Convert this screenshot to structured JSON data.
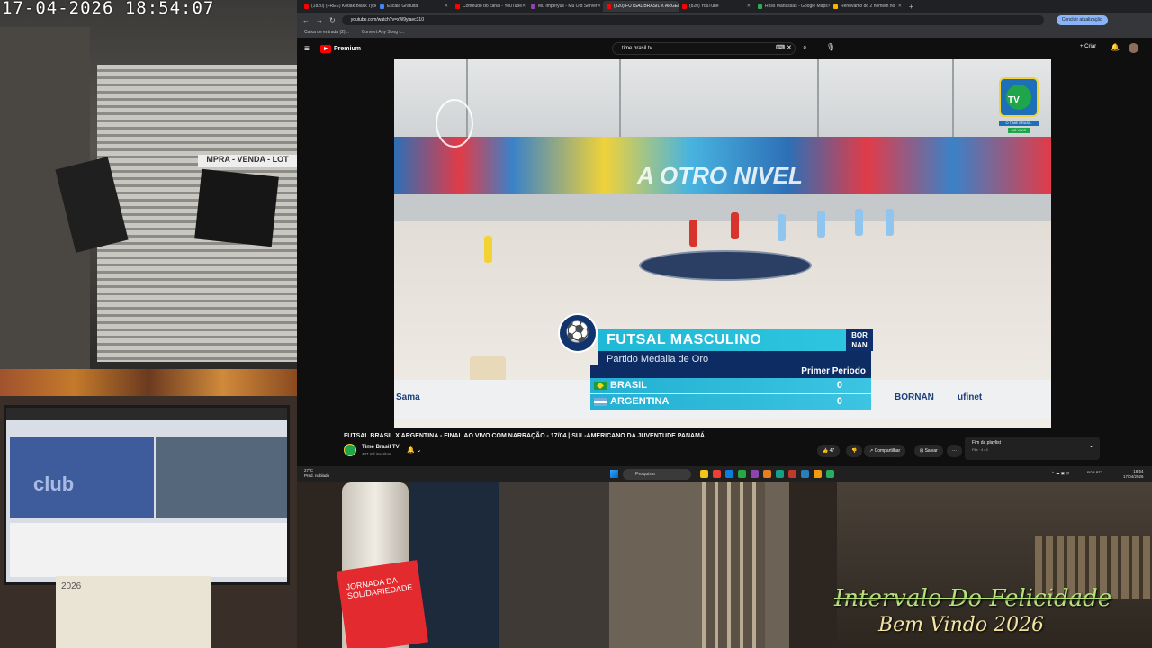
{
  "camera_feeds": {
    "timestamp": "17-04-2026  18:54:07",
    "shop_sign": "MPRA - VENDA - LOT",
    "monitor_text": "club",
    "calendar_year": "2026",
    "overlay_caption_line1": "Intervalo Do Felicidade",
    "overlay_caption_line2": "Bem Vindo 2026"
  },
  "browser": {
    "tabs": [
      {
        "label": "(1820) (FREE) Kodak Black Type",
        "color": "#ff0000",
        "active": false
      },
      {
        "label": "Escala Gratuita",
        "color": "#4285f4",
        "active": false
      },
      {
        "label": "Conteúdo do canal - YouTube",
        "color": "#ff0000",
        "active": false
      },
      {
        "label": "Mu Imperyus - Mu Old Server",
        "color": "#8e44ad",
        "active": false
      },
      {
        "label": "(820) FUTSAL BRASIL X ARGENT",
        "color": "#ff0000",
        "active": true
      },
      {
        "label": "(820) YouTube",
        "color": "#ff0000",
        "active": false
      },
      {
        "label": "Ross Manassas - Google Maps",
        "color": "#34a853",
        "active": false
      },
      {
        "label": "Renovamo do 2 homem no",
        "color": "#f4b400",
        "active": false
      }
    ],
    "new_tab": "+",
    "url": "youtube.com/watch?v=xW9yiaec310",
    "update_button": "Concluir atualização",
    "bookmarks": [
      "Caixa de entrada (2)...",
      "Convert Any Song t..."
    ]
  },
  "youtube": {
    "menu_icon": "≡",
    "logo_word": "Premium",
    "search_value": "time brasil tv",
    "search_icons": "⌨ ✕",
    "search_button": "⌕",
    "mic_button": "🎙",
    "create_label": "+ Criar",
    "bell_icon": "🔔",
    "video_title": "FUTSAL BRASIL X ARGENTINA - FINAL AO VIVO COM NARRAÇÃO - 17/04 | SUL-AMERICANO DA JUVENTUDE PANAMÁ",
    "channel_name": "Time Brasil TV",
    "channel_subs": "447 mil inscritos",
    "subscribe_bell": "🔔 ⌄",
    "like_count": "👍 47",
    "dislike": "👎",
    "share_label": "↗ Compartilhar",
    "save_label": "⊞ Salvar",
    "more_label": "···",
    "playlist_title": "Fim da playlist",
    "playlist_sub": "Fila · 4 / 4",
    "playlist_chevron": "⌄"
  },
  "video_overlay": {
    "channel_badge_label": "O TIME BRASIL",
    "live_tag": "AO VIVO",
    "tv_text": "TV",
    "banner_text": "A OTRO NIVEL",
    "sport_icon": "⚽",
    "event_title": "FUTSAL MASCULINO",
    "event_subtitle": "Partido Medalla de Oro",
    "sponsor": "BOR NAN",
    "period": "Primer Periodo",
    "teams": [
      {
        "name": "BRASIL",
        "score": "0"
      },
      {
        "name": "ARGENTINA",
        "score": "0"
      }
    ],
    "adboards": [
      "Sama",
      "BORNAN",
      "ufinet"
    ]
  },
  "taskbar": {
    "weather_temp": "27°C",
    "weather_desc": "Pred. nublado",
    "search_placeholder": "Pesquisar",
    "lang": "POR PT2",
    "time": "18:54",
    "date": "17/04/2026"
  },
  "room_feed": {
    "card_text": "JORNADA DA SOLIDARIEDADE"
  },
  "colors": {
    "yt_red": "#ff0000",
    "score_cyan": "#23b0d2",
    "score_navy": "#0d2c63",
    "caption_green": "#b6e27a"
  }
}
